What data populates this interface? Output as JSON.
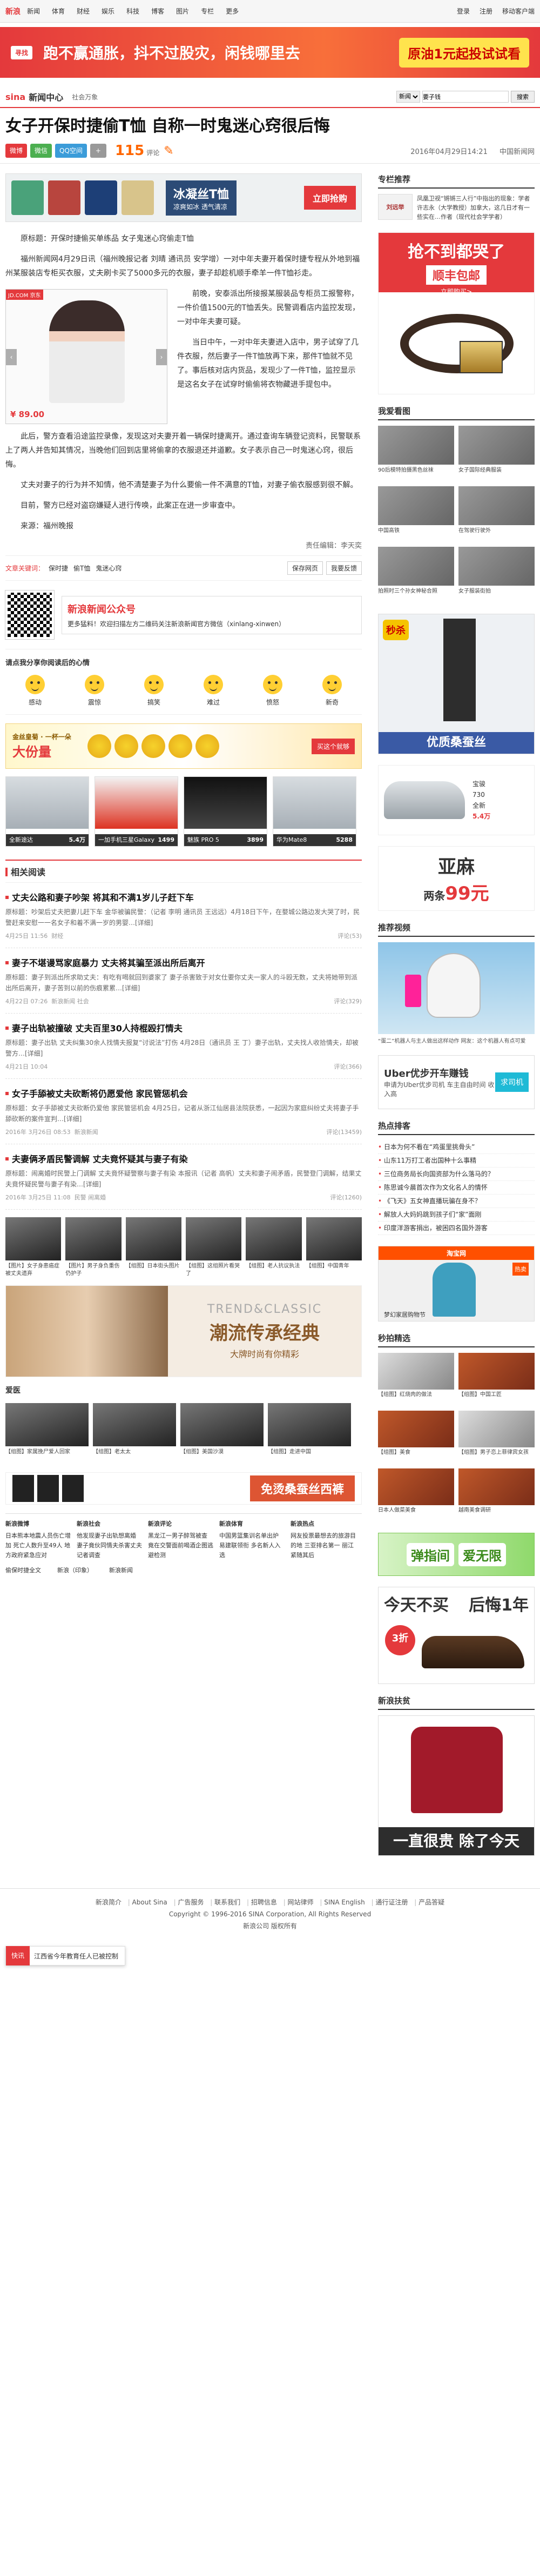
{
  "topnav": {
    "logo": "新浪",
    "items": [
      "新闻",
      "体育",
      "财经",
      "娱乐",
      "科技",
      "博客",
      "图片",
      "专栏",
      "更多"
    ],
    "right": [
      "登录",
      "注册",
      "移动客户端"
    ]
  },
  "banner": {
    "brand": "寻找",
    "slogan": "跑不赢通胀，抖不过股灾，闲钱哪里去",
    "cta": "原油1元起投试试看"
  },
  "channel": {
    "sina": "sina",
    "newscenter": "新闻中心",
    "sub": "社会万象",
    "search_scope": "新闻",
    "search_placeholder": "",
    "search_value": "要子钱",
    "search_button": "搜索"
  },
  "article": {
    "title": "女子开保时捷偷T恤 自称一时鬼迷心窍很后悔",
    "share": {
      "weibo": "微博",
      "wx": "微信",
      "qq": "QQ空间",
      "plus": "+"
    },
    "comment_count": "115",
    "comment_label": "评论",
    "date": "2016年04月29日14:21",
    "source": "中国新闻网",
    "ad_strip": {
      "title": "冰凝丝T恤",
      "sub": "凉爽如冰 透气清凉",
      "buy": "立即抢购"
    },
    "float_ad": {
      "badge": "JD.COM 京东",
      "price": "¥ 89.00"
    },
    "paragraphs": [
      "原标题：开保时捷偷买单练品 女子鬼迷心窍偷走T恤",
      "福州新闻网4月29日讯（福州晚报记者 刘晴 通讯员 安学增）一对中年夫妻开着保时捷专程从外地到福州某服装店专柜买衣服，丈夫刷卡买了5000多元的衣服，妻子却趁机顺手牵羊一件T恤衫走。",
      "前晚，安泰派出所接报某服装品专柜员工报警称，一件价值1500元的T恤丢失。民警调看店内监控发现，一对中年夫妻可疑。",
      "当日中午，一对中年夫妻进入店中，男子试穿了几件衣服，然后妻子一件T恤放再下来，那件T恤就不见了。事后核对店内货品，发现少了一件T恤，监控显示是这名女子在试穿时偷偷将衣物藏进手提包中。",
      "此后，警方查看沿途监控录像，发现这对夫妻开着一辆保时捷离开。通过查询车辆登记资料，民警联系上了两人并告知其情况，当晚他们回到店里将偷拿的衣服退还并道歉。女子表示自己一时鬼迷心窍，很后悔。",
      "丈夫对妻子的行为并不知情，他不清楚妻子为什么要偷一件不满意的T恤，对妻子偷衣服感到很不解。",
      "目前，警方已经对盗窃嫌疑人进行传唤，此案正在进一步审查中。",
      "来源：福州晚报"
    ],
    "editor": "责任编辑：李天奕"
  },
  "tags": {
    "kw_label": "文章关键词：",
    "items": [
      "保时捷",
      "偷T恤",
      "鬼迷心窍"
    ],
    "buttons": [
      "保存网页",
      "我要反馈"
    ]
  },
  "wechat": {
    "title": "新浪新闻公众号",
    "desc": "更多猛料！欢迎扫描左方二维码关注新浪新闻官方微信（xinlang-xinwen）"
  },
  "mood": {
    "title": "请点我分享你阅读后的心情",
    "faces": [
      "感动",
      "震惊",
      "搞笑",
      "难过",
      "愤怒",
      "新奇"
    ]
  },
  "fruit_ad": {
    "t1": "金丝皇菊 · 一杯一朵",
    "t2": "大份量",
    "go": "买这个就够"
  },
  "products": [
    {
      "name": "全新途达",
      "price": "5.4万"
    },
    {
      "name": "一加手机三星Galaxy",
      "price": "1499"
    },
    {
      "name": "魅族 PRO 5",
      "price": "3899"
    },
    {
      "name": "华为Mate8",
      "price": "5288"
    }
  ],
  "related": {
    "title": "相关阅读",
    "items": [
      {
        "title": "丈夫公路和妻子吵架 将其和不满1岁儿子赶下车",
        "desc": "原标题：吵架后丈夫把妻儿赶下车 金华被骗民警：（记者 李明 通讯员 王远远）4月18日下午，在婺城公路边发大哭了时，民警赶来安慰一一名女子和着不满一岁的男婴…[详细]",
        "date": "4月25日 11:56",
        "tag": "财经",
        "comments": "评论(53)"
      },
      {
        "title": "妻子不堪谩骂家庭暴力 丈夫将其骗至派出所后离开",
        "desc": "原标题：妻子到派出所求助丈夫：有吃有喝就回到婆家了 妻子杀害致于对女仕要你丈夫一家人的斗殴无数，丈夫将她带到派出所后离开，妻子苦到以前的伤痕累累…[详细]",
        "date": "4月22日 07:26",
        "tag": "新浪新闻 社会",
        "comments": "评论(329)"
      },
      {
        "title": "妻子出轨被撞破 丈夫百里30人持棍殴打情夫",
        "desc": "原标题：妻子出轨 丈夫纠集30余人找情夫报复“讨说法”打伤 4月28日（通讯员 王 丁）妻子出轨，丈夫找人收拾情夫，却被警方…[详细]",
        "date": "4月21日 10:04",
        "tag": "",
        "comments": "评论(366)"
      },
      {
        "title": "女子手舔被丈夫砍断将仍愿爱他 家民管惩机会",
        "desc": "原标题：女子手舔被丈夫砍断仍爱他 家民管惩机会 4月25日，记者从浙江仙居县法院获悉，一起因为家庭纠纷丈夫将妻子手舔砍断的案件宣判…[详细]",
        "date": "2016年 3月26日 08:53",
        "tag": "新浪新闻",
        "comments": "评论(13459)"
      },
      {
        "title": "夫妻俩矛盾民警调解 丈夫竟怀疑其与妻子有染",
        "desc": "原标题：闹离婚时民警上门调解 丈夫竟怀疑警察与妻子有染 本报讯（记者 高帆）丈夫和妻子闹矛盾，民警登门调解，结果丈夫竟怀疑民警与妻子有染…[详细]",
        "date": "2016年 3月25日 11:08",
        "tag": "民警 闹离婚",
        "comments": "评论(1260)"
      }
    ]
  },
  "photos": [
    "【图片】女子身患癌症被丈夫遗弃",
    "【图片】男子身负重伤仍护子",
    "【组图】日本街头图片",
    "【组图】这组照片看哭了",
    "【组图】老人抗议执法",
    "【组图】中国青年"
  ],
  "coat_ad": {
    "en": "TREND&CLASSIC",
    "zh": "潮流传承经典",
    "sub": "大牌时尚有你精彩"
  },
  "hot_sub": "爱医",
  "photos2": [
    "【组图】家属挽尸爱人回家",
    "【组图】老太太",
    "【组图】美国沙漠",
    "【组图】走进中国"
  ],
  "pants_ad": {
    "t": "免烫桑蚕丝西裤"
  },
  "links_grid": [
    {
      "h": "新浪微博",
      "t": "日本熊本地震人员伤亡增加 死亡人数升至49人 地方政府紧急应对"
    },
    {
      "h": "新浪社会",
      "t": "他发现妻子出轨想离婚 妻子竟伙同情夫杀害丈夫 记者调查"
    },
    {
      "h": "新浪评论",
      "t": "黑龙江一男子醉驾被查 竟在交警面前喝酒企图逃避检测"
    },
    {
      "h": "新浪体育",
      "t": "中国男篮集训名单出炉 易建联领衔 多名新人入选"
    },
    {
      "h": "新浪热点",
      "t": "网友投票最想去的旅游目的地 三亚排名第一 丽江紧随其后"
    }
  ],
  "links_foot": [
    "偷保时捷全文",
    "新浪（印象）",
    "新浪新闻"
  ],
  "side": {
    "spec_title": "专栏推荐",
    "spec_logo": "刘远举",
    "spec_text": "凤凰卫视“锵锵三人行”中指出的现象：学者许志永（大学教授）加拿大，这几日才有一些实在…作者（现代社会学学者）",
    "belt_ad": {
      "t1": "抢不到都哭了",
      "t2": "顺丰包邮",
      "t3": "立即购买>"
    },
    "hot_title": "我爱看图",
    "hot_items": [
      "90后模特拍摄黑色丝袜",
      "女子国际经典服装",
      "中国高铁",
      "在驾驶行驶外",
      "拍照时三个孙女神秘合照",
      "女子服装街拍"
    ],
    "silk_ad": {
      "badge": "秒杀",
      "foot": "优质桑蚕丝"
    },
    "car_ad": {
      "name": "宝骏",
      "model": "730",
      "sub": "全新",
      "price": "5.4万"
    },
    "flax_ad": {
      "a": "亚麻",
      "b": "两条",
      "price": "99元"
    },
    "video_title": "推荐视频",
    "video_cap": "“蛋二”机器人与主人做出这样动作 网友：这个机器人有点可爱",
    "uber": {
      "t": "Uber优步开车赚钱",
      "s": "申请为Uber优步司机 车主自由时间 收入高",
      "b": "求司机"
    },
    "hotwords_title": "热点排客",
    "hotwords": [
      "日本为何不看在“鸡蛋里挑骨头”",
      "山东11万打工者出国种十么事精",
      "三位商务局长向国资部为什么落马的？",
      "陈思诚今晨首次作为文化名人的情怀",
      "《飞天》五女神直播玩骗在身不？",
      "解放人大妈妈跳到孩子们“家”面刚",
      "印度洋游客捐出，被困四名国外游客"
    ],
    "tb_ad": {
      "hd": "淘宝网",
      "tag": "热卖",
      "foot": "梦幻家居购物节"
    },
    "food_title": "秒拍精选",
    "food": [
      "【组图】红烧肉的做法",
      "【组图】中国工匠",
      "【组图】美食",
      "【组图】男子恋上菲律宾女孩",
      "日本人做菜美食",
      "越南美食调研"
    ],
    "spring_ad": {
      "a": "弹指间",
      "b": "爱无限"
    },
    "shoe_ad": {
      "t1": "今天不买",
      "t2": "后悔1年",
      "disc": "3折"
    },
    "shirt_title": "新浪扶贫",
    "shirt_ad": {
      "foot": "一直很贵 除了今天"
    }
  },
  "footer": {
    "links": [
      "新浪简介",
      "About Sina",
      "广告服务",
      "联系我们",
      "招聘信息",
      "网站律师",
      "SINA English",
      "通行证注册",
      "产品答疑"
    ],
    "copy": "Copyright © 1996-2016 SINA Corporation, All Rights Reserved",
    "company": "新浪公司 版权所有"
  },
  "floatbar": {
    "btn": "快讯",
    "text": "江西省今年教育任人已被控制"
  }
}
